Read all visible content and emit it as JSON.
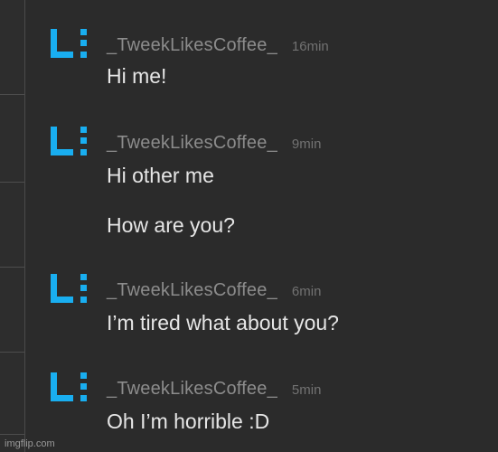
{
  "messages": [
    {
      "username": "_TweekLikesCoffee_",
      "time": "16min",
      "avatar_icon": "L-colon-logo-icon",
      "lines": [
        "Hi me!"
      ]
    },
    {
      "username": "_TweekLikesCoffee_",
      "time": "9min",
      "avatar_icon": "L-colon-logo-icon",
      "lines": [
        "Hi other me",
        "How are you?"
      ]
    },
    {
      "username": "_TweekLikesCoffee_",
      "time": "6min",
      "avatar_icon": "L-colon-logo-icon",
      "lines": [
        "I’m tired what about you?"
      ]
    },
    {
      "username": "_TweekLikesCoffee_",
      "time": "5min",
      "avatar_icon": "L-colon-logo-icon",
      "lines": [
        "Oh I’m horrible :D"
      ]
    }
  ],
  "watermark": "imgflip.com",
  "colors": {
    "background": "#2b2b2b",
    "avatar_blue": "#19aef0",
    "username": "#8c8c8c",
    "timestamp": "#727272",
    "message_text": "#e6e6e6"
  }
}
